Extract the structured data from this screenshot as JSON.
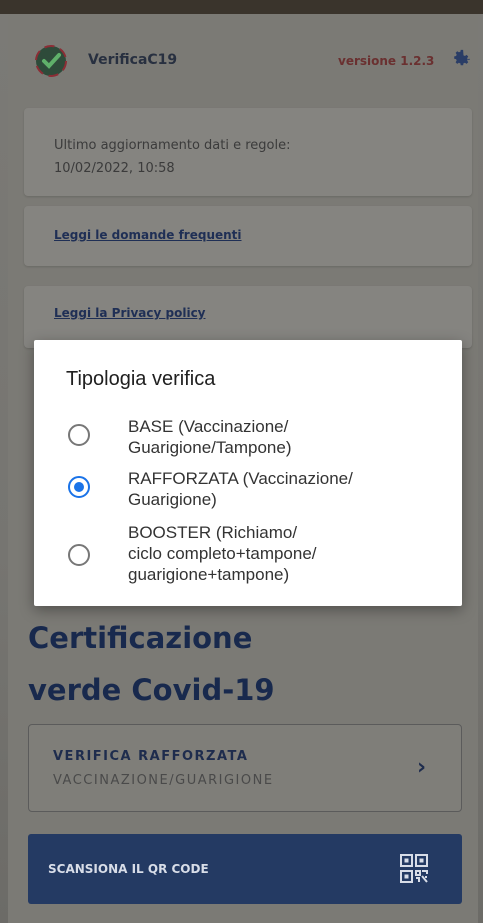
{
  "header": {
    "app_name": "VerificaC19",
    "version": "versione 1.2.3",
    "logo_icon": "verificac19-logo-icon",
    "settings_icon": "gear-icon",
    "accent_color": "#243a63"
  },
  "update_card": {
    "label": "Ultimo aggiornamento dati e regole:",
    "datetime": "10/02/2022, 10:58"
  },
  "links": {
    "faq": "Leggi le domande frequenti",
    "privacy": "Leggi la Privacy policy"
  },
  "dialog": {
    "title": "Tipologia verifica",
    "options": [
      {
        "line1": "BASE (Vaccinazione/",
        "line2": "Guarigione/Tampone)",
        "line3": "",
        "selected": false
      },
      {
        "line1": "RAFFORZATA (Vaccinazione/",
        "line2": "Guarigione)",
        "line3": "",
        "selected": true
      },
      {
        "line1": "BOOSTER (Richiamo/",
        "line2": "ciclo completo+tampone/",
        "line3": "guarigione+tampone)",
        "selected": false
      }
    ],
    "radio_color": "#1a73e8"
  },
  "main": {
    "title_line1": "Certificazione",
    "title_line2": "verde Covid-19",
    "mode_title": "VERIFICA RAFFORZATA",
    "mode_subtitle": "VACCINAZIONE/GUARIGIONE",
    "scan_label": "SCANSIONA IL QR CODE",
    "qr_icon": "qr-code-icon"
  }
}
